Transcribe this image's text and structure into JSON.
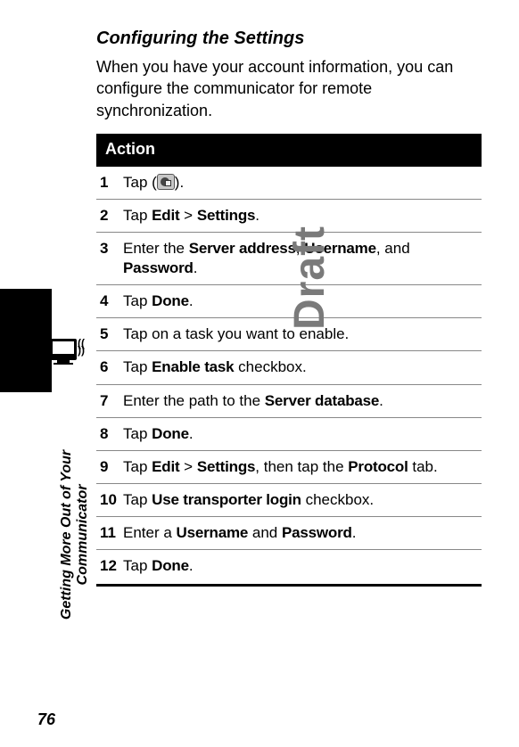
{
  "section_title": "Configuring the Settings",
  "intro": "When you have your account information, you can configure the communicator for remote synchronization.",
  "action_header": "Action",
  "steps": [
    {
      "n": "1",
      "pre": "Tap (",
      "icon": true,
      "post": ")."
    },
    {
      "n": "2",
      "html": "Tap <b>Edit</b> > <b>Settings</b>."
    },
    {
      "n": "3",
      "html": "Enter the <b>Server address</b>, <b>Username</b>, and <b>Password</b>."
    },
    {
      "n": "4",
      "html": "Tap <b>Done</b>."
    },
    {
      "n": "5",
      "html": "Tap on a task you want to enable."
    },
    {
      "n": "6",
      "html": "Tap <b>Enable task</b> checkbox."
    },
    {
      "n": "7",
      "html": "Enter the path to the <b>Server database</b>."
    },
    {
      "n": "8",
      "html": "Tap <b>Done</b>."
    },
    {
      "n": "9",
      "html": "Tap <b>Edit</b> > <b>Settings</b>, then tap the <b>Protocol</b> tab."
    },
    {
      "n": "10",
      "html": "Tap <b>Use transporter login</b> checkbox."
    },
    {
      "n": "11",
      "html": "Enter a <b>Username</b> and <b>Password</b>."
    },
    {
      "n": "12",
      "html": "Tap <b>Done</b>."
    }
  ],
  "watermark": "Draft",
  "side_label_line1": "Getting More Out of Your",
  "side_label_line2": "Communicator",
  "page_number": "76"
}
